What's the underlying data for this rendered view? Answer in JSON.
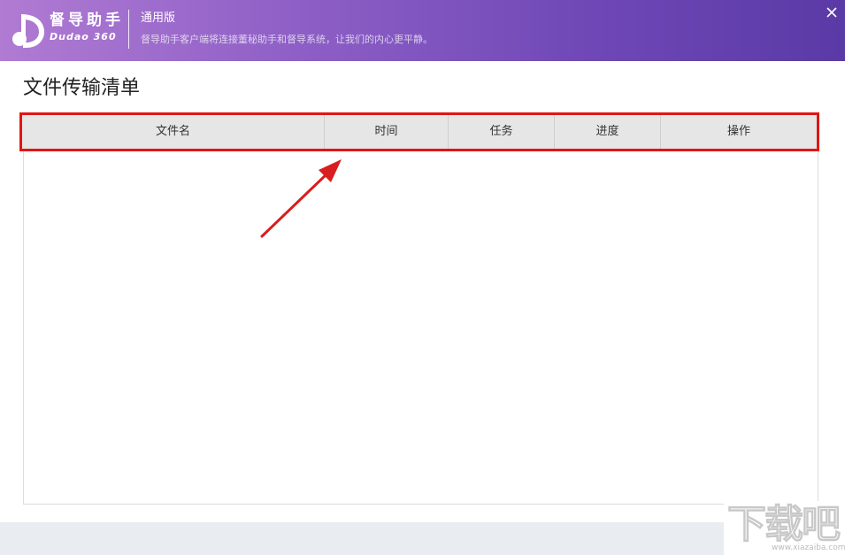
{
  "header": {
    "brand_cn": "督导助手",
    "brand_en": "Dudao 360",
    "edition": "通用版",
    "tagline": "督导助手客户端将连接董秘助手和督导系统，让我们的内心更平静。"
  },
  "page": {
    "title": "文件传输清单"
  },
  "table": {
    "columns": [
      "文件名",
      "时间",
      "任务",
      "进度",
      "操作"
    ],
    "rows": []
  },
  "watermark": {
    "text": "下载吧",
    "url": "www.xiazaiba.com"
  },
  "colors": {
    "header_gradient_start": "#b07bd3",
    "header_gradient_end": "#5a3aa6",
    "highlight_border": "#e01515",
    "table_header_bg": "#e6e6e6",
    "footer_bg": "#e9edf1"
  },
  "icons": {
    "logo": "dudao-logo-icon",
    "close": "close-icon",
    "annotation": "red-arrow-icon"
  }
}
